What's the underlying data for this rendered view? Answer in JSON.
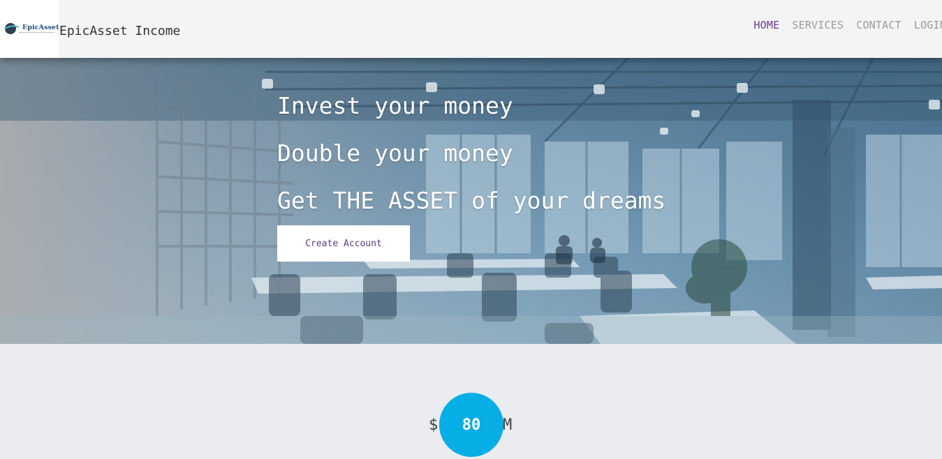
{
  "header": {
    "logo_text": "EpicAsset",
    "brand_name": "EpicAsset Income",
    "nav": [
      {
        "label": "HOME",
        "active": true
      },
      {
        "label": "SERVICES",
        "active": false
      },
      {
        "label": "CONTACT",
        "active": false
      },
      {
        "label": "LOGIN",
        "active": false
      }
    ]
  },
  "hero": {
    "lines": [
      "Invest your money",
      "Double your money",
      "Get THE ASSET of your dreams"
    ],
    "cta_label": "Create Account"
  },
  "stat": {
    "prefix": "$",
    "value": "80",
    "suffix": "M"
  },
  "colors": {
    "accent_purple": "#6a3a8e",
    "stat_circle": "#06aee6",
    "header_bg": "#f4f4f4",
    "page_bg": "#ebecef"
  }
}
